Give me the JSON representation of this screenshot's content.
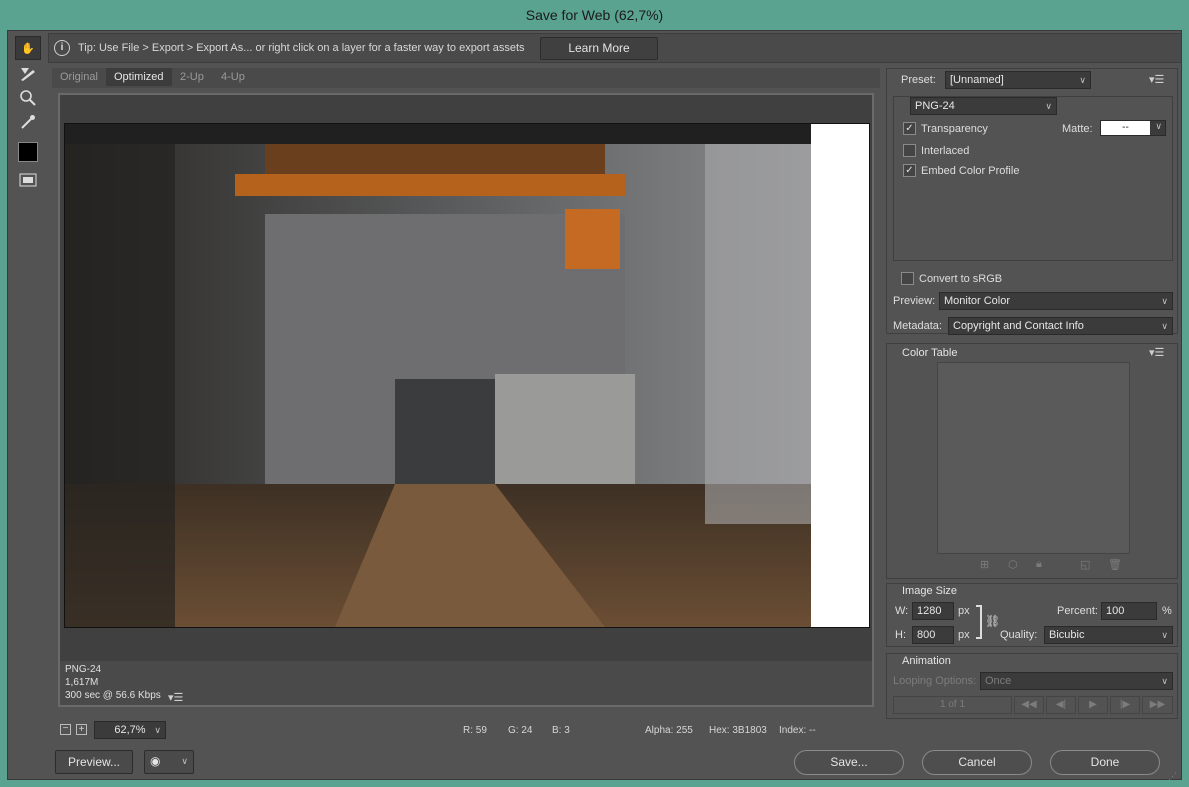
{
  "window": {
    "title": "Save for Web (62,7%)"
  },
  "tip": {
    "text": "Tip: Use File > Export > Export As...  or right click on a layer for a faster way to export assets",
    "button": "Learn More"
  },
  "tabs": [
    "Original",
    "Optimized",
    "2-Up",
    "4-Up"
  ],
  "image_info": {
    "format": "PNG-24",
    "size": "1,617M",
    "speed": "300 sec @ 56.6 Kbps"
  },
  "status": {
    "zoom": "62,7%",
    "r": "R: 59",
    "g": "G: 24",
    "b": "B: 3",
    "alpha": "Alpha: 255",
    "hex": "Hex: 3B1803",
    "index": "Index: --"
  },
  "bottom": {
    "preview": "Preview...",
    "save": "Save...",
    "cancel": "Cancel",
    "done": "Done"
  },
  "settings": {
    "preset_label": "Preset:",
    "preset": "[Unnamed]",
    "format": "PNG-24",
    "transparency": "Transparency",
    "matte_label": "Matte:",
    "matte": "--",
    "interlaced": "Interlaced",
    "embed": "Embed Color Profile",
    "convert": "Convert to sRGB",
    "preview_label": "Preview:",
    "preview": "Monitor Color",
    "metadata_label": "Metadata:",
    "metadata": "Copyright and Contact Info"
  },
  "color_table": {
    "title": "Color Table"
  },
  "image_size": {
    "title": "Image Size",
    "w_label": "W:",
    "w": "1280",
    "h_label": "H:",
    "h": "800",
    "unit": "px",
    "percent_label": "Percent:",
    "percent": "100",
    "pct": "%",
    "quality_label": "Quality:",
    "quality": "Bicubic"
  },
  "animation": {
    "title": "Animation",
    "looping_label": "Looping Options:",
    "looping": "Once",
    "frame": "1 of 1"
  },
  "colors": {
    "accent": "#5ba391",
    "panel": "#535353"
  }
}
